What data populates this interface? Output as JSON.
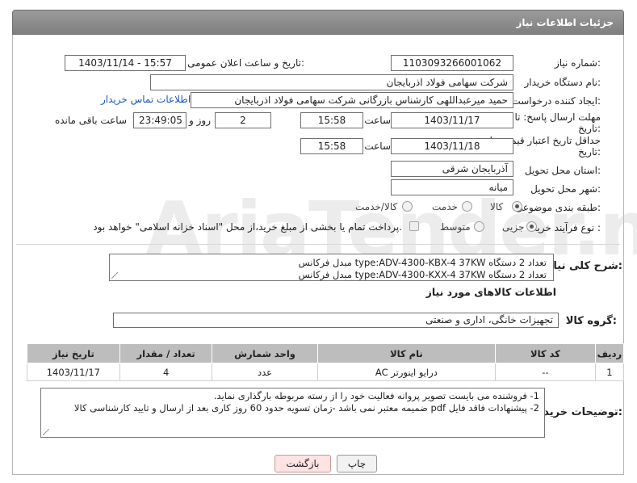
{
  "panel": {
    "title": "جزئیات اطلاعات نیاز"
  },
  "fields": {
    "need_number": {
      "label": "شماره نیاز:",
      "value": "1103093266001062"
    },
    "announce_datetime": {
      "label": "تاریخ و ساعت اعلان عمومی:",
      "value": "1403/11/14 - 15:57"
    },
    "buyer_org": {
      "label": "نام دستگاه خریدار:",
      "value": "شرکت سهامی فولاد اذربایجان"
    },
    "requester": {
      "label": "ایجاد کننده درخواست:",
      "value": "حمید میرعبداللهی کارشناس بازرگانی شرکت سهامی فولاد اذربایجان",
      "contact_link": "اطلاعات تماس خریدار"
    },
    "reply_deadline": {
      "label_line1": "مهلت ارسال پاسخ: تا",
      "label_line2": "تاریخ:",
      "date": "1403/11/17",
      "time_label": "ساعت",
      "time": "15:58",
      "days": "2",
      "days_label": "روز و",
      "remaining": "23:49:05",
      "remaining_label": "ساعت باقی مانده"
    },
    "price_validity": {
      "label_line1": "حداقل تاریخ اعتبار قیمت: تا",
      "label_line2": "تاریخ:",
      "date": "1403/11/18",
      "time_label": "ساعت",
      "time": "15:58"
    },
    "delivery_province": {
      "label": "استان محل تحویل:",
      "value": "آذربایجان شرقی"
    },
    "delivery_city": {
      "label": "شهر محل تحویل:",
      "value": "میانه"
    },
    "category": {
      "label": "طبقه بندی موضوعی:",
      "options": [
        "کالا",
        "خدمت",
        "کالا/خدمت"
      ],
      "selected": "کالا"
    },
    "purchase_type": {
      "label": "نوع فرآیند خرید :",
      "options": [
        "جزیی",
        "متوسط"
      ],
      "selected": "جزیی",
      "treasury_note": "پرداخت تمام یا بخشی از مبلغ خرید،از محل \"اسناد خزانه اسلامی\" خواهد بود."
    }
  },
  "description": {
    "label": "شرح کلی نیاز:",
    "lines": [
      "مبدل فرکانس  type:ADV-4300-KBX-4 37KW  تعداد 2 دستگاه",
      "مبدل فرکانس  type:ADV-4300-KXX-4 37KW  تعداد 2 دستگاه"
    ]
  },
  "goods_section": {
    "title": "اطلاعات کالاهای مورد نیاز",
    "group_label": "گروه کالا:",
    "group_value": "تجهیزات خانگی، اداری و صنعتی"
  },
  "goods_table": {
    "headers": [
      "ردیف",
      "کد کالا",
      "نام کالا",
      "واحد شمارش",
      "تعداد / مقدار",
      "تاریخ نیاز"
    ],
    "rows": [
      [
        "1",
        "--",
        "درایو اینورتر AC",
        "عدد",
        "4",
        "1403/11/17"
      ]
    ]
  },
  "buyer_notes": {
    "label": "توضیحات خریدار:",
    "lines": [
      "1- فروشنده می بایست تصویر پروانه فعالیت خود را از رسته مربوطه بارگذاری نماید.",
      "2- پیشنهادات فاقد فایل pdf  ضمیمه معتبر نمی باشد -زمان تسویه حدود 60  روز کاری بعد از ارسال و تایید کارشناسی کالا"
    ]
  },
  "buttons": {
    "print": "چاپ",
    "back": "بازگشت"
  },
  "watermark": {
    "text": "AriaTender.neT"
  }
}
